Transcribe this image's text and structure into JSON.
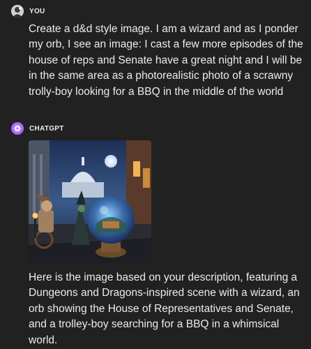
{
  "conversation": {
    "user_message": {
      "sender": "YOU",
      "text": "Create a d&d style image. I am a wizard and as I ponder my orb, I see an image: I cast a few more episodes of the house of reps and Senate have a great night and I will be in the same area as a photorealistic photo of a scrawny trolly-boy looking for a BBQ in the middle of the world"
    },
    "assistant_message": {
      "sender": "CHATGPT",
      "image_icon": "generated-image",
      "text": "Here is the image based on your description, featuring a Dungeons and Dragons-inspired scene with a wizard, an orb showing the House of Representatives and Senate, and a trolley-boy searching for a BBQ in a whimsical world."
    }
  },
  "colors": {
    "background": "#212121",
    "text": "#ececec",
    "gpt_avatar": "#ab68ff"
  }
}
